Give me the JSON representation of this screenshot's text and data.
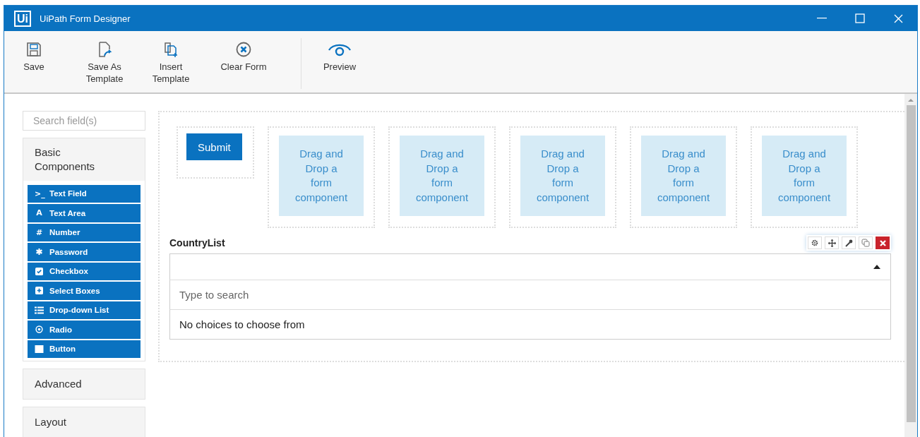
{
  "window": {
    "logo": "Ui",
    "title": "UiPath Form Designer"
  },
  "toolbar": [
    {
      "kind": "save",
      "label": "Save"
    },
    {
      "kind": "save-as",
      "label": "Save As Template"
    },
    {
      "kind": "insert",
      "label": "Insert Template"
    },
    {
      "kind": "clear",
      "label": "Clear Form"
    },
    {
      "kind": "preview",
      "label": "Preview"
    }
  ],
  "sidebar": {
    "search": {
      "placeholder": "Search field(s)"
    },
    "groups": [
      {
        "label": "Basic Components",
        "expanded": true,
        "items": [
          {
            "kind": "textfield",
            "icon": ">_",
            "label": "Text Field"
          },
          {
            "kind": "textarea",
            "icon": "A",
            "label": "Text Area"
          },
          {
            "kind": "number",
            "icon": "#",
            "label": "Number"
          },
          {
            "kind": "password",
            "label": "Password"
          },
          {
            "kind": "checkbox",
            "label": "Checkbox"
          },
          {
            "kind": "selectboxes",
            "label": "Select Boxes"
          },
          {
            "kind": "dropdown",
            "label": "Drop-down List"
          },
          {
            "kind": "radio",
            "label": "Radio"
          },
          {
            "kind": "button",
            "label": "Button"
          }
        ]
      },
      {
        "label": "Advanced",
        "expanded": false
      },
      {
        "label": "Layout",
        "expanded": false
      }
    ]
  },
  "canvas": {
    "submit_button": "Submit",
    "drop_zones": [
      "Drag and Drop a form component",
      "Drag and Drop a form component",
      "Drag and Drop a form component",
      "Drag and Drop a form component",
      "Drag and Drop a form component"
    ],
    "component": {
      "label": "CountryList",
      "actions": [
        {
          "kind": "settings"
        },
        {
          "kind": "move"
        },
        {
          "kind": "edit"
        },
        {
          "kind": "copy"
        },
        {
          "kind": "remove"
        }
      ],
      "search": {
        "placeholder": "Type to search"
      },
      "empty_message": "No choices to choose from"
    }
  }
}
